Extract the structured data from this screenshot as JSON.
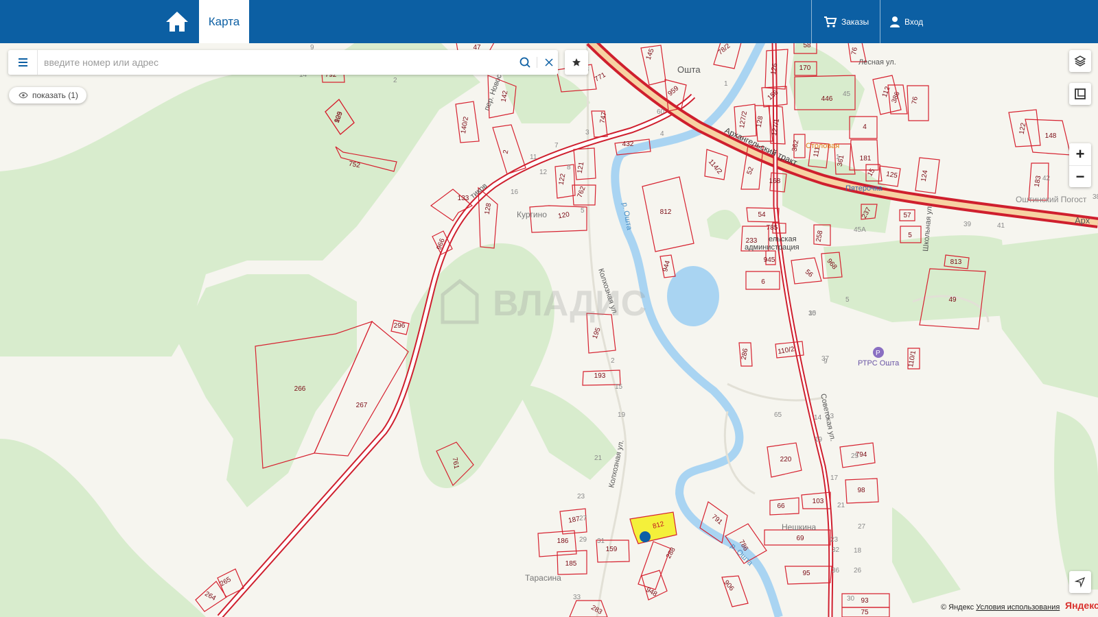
{
  "topbar": {
    "map_tab": "Карта",
    "orders_label": "Заказы",
    "login_label": "Вход"
  },
  "search": {
    "placeholder": "введите номер или адрес"
  },
  "show_button": {
    "label": "показать (1)"
  },
  "map": {
    "watermark": "ВЛАДИС",
    "places": {
      "oshta": "Ошта",
      "kurgino": "Кургино",
      "tarasina": "Тарасина",
      "neshkina": "Нешкина",
      "oshtinsky_pogost": "Оштинский Погост",
      "arkh": "Арх",
      "stolovaya": "Столовая",
      "pyaterochka": "Пятерочка",
      "rtrs": "РТРС Ошта",
      "selskaya_adm_1": "ельская",
      "selskaya_adm_2": "администрация"
    },
    "streets": {
      "arkhangelsky_trakt": "Архангельский тракт",
      "kolkhoznaya_1": "Колхозная ул.",
      "kolkhoznaya_2": "Колхозная ул.",
      "sovetskaya": "Советская ул.",
      "shkolnaya": "Школьная ул.",
      "lesnaya": "Лесная ул.",
      "per_novoselov": "пер. Новосел",
      "r_oshta_1": "р. Ошта",
      "r_oshta_2": "р. Ошта",
      "tikov": "тиков"
    },
    "parcels": [
      "905",
      "752",
      "266",
      "267",
      "296",
      "265",
      "264",
      "761",
      "966",
      "133",
      "128",
      "140/2",
      "142",
      "2",
      "122",
      "121",
      "762",
      "120",
      "195",
      "193",
      "187",
      "186",
      "185",
      "159",
      "283",
      "288",
      "948",
      "906",
      "791",
      "786",
      "812",
      "944",
      "747",
      "771",
      "959",
      "432",
      "114/2",
      "127/2",
      "128",
      "127/1",
      "126",
      "156",
      "170",
      "446",
      "112",
      "386",
      "76",
      "362",
      "111",
      "361",
      "181",
      "4",
      "15",
      "125",
      "124",
      "122",
      "148",
      "183",
      "168",
      "52",
      "54",
      "785",
      "233",
      "945",
      "6",
      "56",
      "968",
      "258",
      "237",
      "57",
      "5",
      "813",
      "49",
      "286",
      "110/2",
      "110/1",
      "220",
      "794",
      "66",
      "103",
      "98",
      "69",
      "95",
      "93",
      "75",
      "76",
      "58",
      "78/2",
      "47",
      "792",
      "145",
      "129"
    ],
    "house_numbers": [
      "14",
      "2",
      "9",
      "11",
      "12",
      "16",
      "8",
      "7",
      "3",
      "4",
      "5",
      "60",
      "65",
      "83",
      "1",
      "2",
      "15",
      "19",
      "21",
      "23",
      "27",
      "29",
      "31",
      "33",
      "35",
      "37",
      "10",
      "14",
      "19",
      "25",
      "27",
      "18",
      "26",
      "30",
      "32",
      "36",
      "39",
      "41",
      "42",
      "38",
      "45",
      "45А",
      "1",
      "5",
      "9",
      "13",
      "17",
      "21",
      "23"
    ]
  },
  "attribution": {
    "copyright": "© Яндекс",
    "terms": "Условия использования",
    "logo": "Яндекс"
  }
}
